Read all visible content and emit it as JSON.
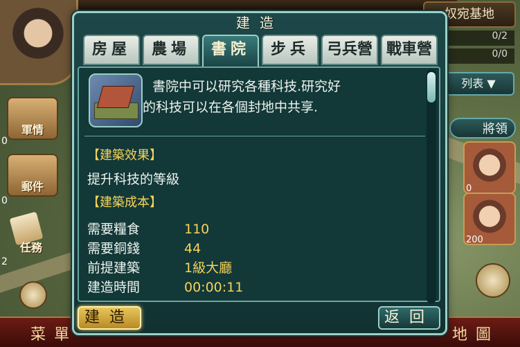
{
  "hud": {
    "base_title": "奴宛基地",
    "stat1": "0/2",
    "stat2": "0/0",
    "list_label": "列表",
    "generals_label": "將領",
    "left_menu": [
      {
        "label": "軍情",
        "count": "0"
      },
      {
        "label": "郵件",
        "count": "0"
      },
      {
        "label": "任務",
        "count": "2"
      }
    ],
    "portraits": [
      {
        "count": "0"
      },
      {
        "count": "200"
      }
    ],
    "bottom_left": "菜單",
    "bottom_right": "地圖"
  },
  "dialog": {
    "title": "建造",
    "tabs": [
      {
        "label": "房屋",
        "active": false
      },
      {
        "label": "農場",
        "active": false
      },
      {
        "label": "書院",
        "active": true
      },
      {
        "label": "步兵營",
        "active": false
      },
      {
        "label": "弓兵營",
        "active": false
      },
      {
        "label": "戰車營",
        "active": false
      }
    ],
    "description_line1": "書院中可以研究各種科技.研究好",
    "description_line2": "的科技可以在各個封地中共享.",
    "effect_header": "【建築效果】",
    "effect_text": "提升科技的等級",
    "cost_header": "【建築成本】",
    "costs": [
      {
        "key": "需要糧食",
        "value": "110"
      },
      {
        "key": "需要銅錢",
        "value": "44"
      },
      {
        "key": "前提建築",
        "value": "1級大廳"
      },
      {
        "key": "建造時間",
        "value": "00:00:11"
      }
    ],
    "build_button": "建造",
    "back_button": "返回"
  },
  "colors": {
    "panel": "#123838",
    "frame": "#9ad0c8",
    "accent_yellow": "#f6d45a",
    "tab_active": "#2b6a6a"
  }
}
